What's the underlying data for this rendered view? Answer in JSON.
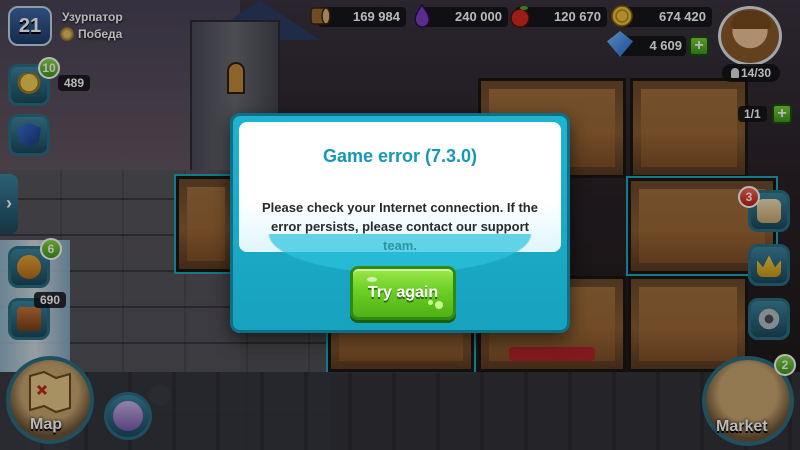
{
  "player": {
    "level": "21",
    "name": "Узурпатор",
    "status": "Победа"
  },
  "resources": {
    "wood": "169 984",
    "mana": "240 000",
    "food": "120 670",
    "gold": "674 420",
    "gems": "4 609"
  },
  "population": "14/30",
  "left_panel": {
    "trophy_badge": "10",
    "trophy_value": "489",
    "quest_badge": "6",
    "chest_value": "690",
    "map_label": "Map"
  },
  "right_panel": {
    "room_counter": "1/1",
    "scroll_badge": "3",
    "market_badge": "2",
    "market_label": "Market"
  },
  "dialog": {
    "title": "Game error (7.3.0)",
    "message": "Please check your Internet connection. If the error persists, please contact our support team.",
    "button_label": "Try again"
  },
  "icons": {
    "wood": "log-icon",
    "mana": "mana-drop-icon",
    "food": "apple-icon",
    "gold": "gold-coin-icon",
    "gems": "gem-icon"
  },
  "colors": {
    "dialog_frame": "#17a2bf",
    "dialog_title": "#1597b8",
    "button_green": "#6ccf24",
    "badge_green": "#3f9a1b",
    "badge_red": "#c21d14"
  }
}
